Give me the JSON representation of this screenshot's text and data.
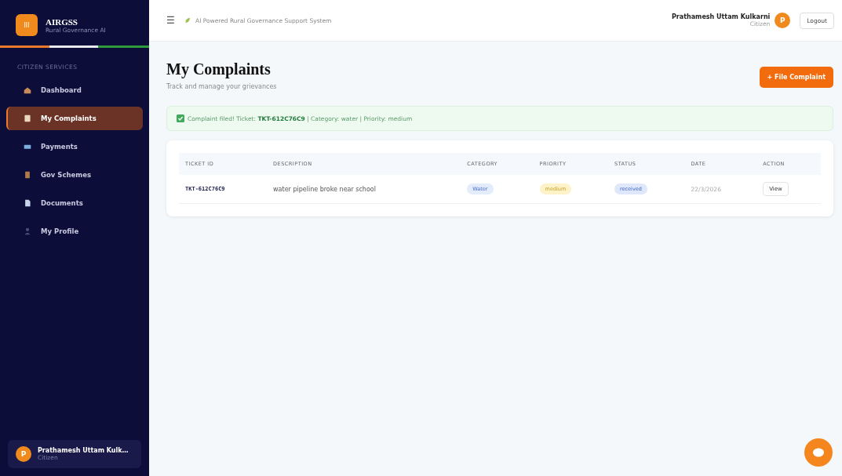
{
  "brand": {
    "logo": "III",
    "name": "AIRGSS",
    "subtitle": "Rural Governance AI"
  },
  "sidebar": {
    "section": "CITIZEN SERVICES",
    "items": [
      {
        "label": "Dashboard",
        "selected": false
      },
      {
        "label": "My Complaints",
        "selected": true
      },
      {
        "label": "Payments",
        "selected": false
      },
      {
        "label": "Gov Schemes",
        "selected": false
      },
      {
        "label": "Documents",
        "selected": false
      },
      {
        "label": "My Profile",
        "selected": false
      }
    ],
    "user": {
      "initial": "P",
      "name": "Prathamesh Uttam Kulk…",
      "role": "Citizen"
    }
  },
  "topbar": {
    "menu": "☰",
    "tagline": "AI Powered Rural Governance Support System",
    "user_name": "Prathamesh Uttam Kulkarni",
    "user_role": "Citizen",
    "avatar": "P",
    "logout": "Logout"
  },
  "page": {
    "title": "My Complaints",
    "subtitle": "Track and manage your grievances",
    "action": "+ File Complaint"
  },
  "alert": {
    "before": "Complaint filed! Ticket:",
    "ticket": "TKT-612C76C9",
    "after": "| Category: water | Priority: medium"
  },
  "table": {
    "columns": [
      "TICKET ID",
      "DESCRIPTION",
      "CATEGORY",
      "PRIORITY",
      "STATUS",
      "DATE",
      "ACTION"
    ],
    "rows": [
      {
        "ticket": "TKT-612C76C9",
        "description": "water pipeline broke near school",
        "category": "Water",
        "priority": "medium",
        "status": "received",
        "date": "22/3/2026",
        "action": "View"
      }
    ]
  }
}
